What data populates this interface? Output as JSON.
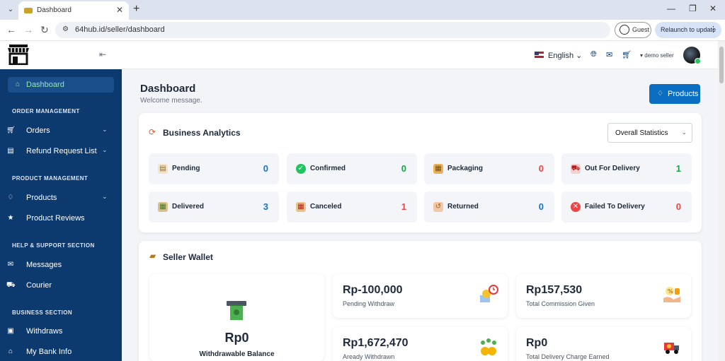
{
  "browser": {
    "tab_title": "Dashboard",
    "url": "64hub.id/seller/dashboard",
    "guest_label": "Guest",
    "relaunch_label": "Relaunch to update"
  },
  "sidebar": {
    "items": [
      {
        "label": "Dashboard",
        "icon": "home-icon"
      },
      {
        "label": "Orders",
        "icon": "cart-icon"
      },
      {
        "label": "Refund Request List",
        "icon": "list-icon"
      },
      {
        "label": "Products",
        "icon": "diamond-icon"
      },
      {
        "label": "Product Reviews",
        "icon": "star-icon"
      },
      {
        "label": "Messages",
        "icon": "message-icon"
      },
      {
        "label": "Courier",
        "icon": "courier-icon"
      },
      {
        "label": "Withdraws",
        "icon": "withdraw-icon"
      },
      {
        "label": "My Bank Info",
        "icon": "bank-icon"
      }
    ],
    "sections": [
      "ORDER MANAGEMENT",
      "PRODUCT MANAGEMENT",
      "HELP & SUPPORT SECTION",
      "BUSINESS SECTION"
    ]
  },
  "header": {
    "language": "English",
    "username": "demo seller"
  },
  "main": {
    "title": "Dashboard",
    "subtitle": "Welcome message.",
    "products_button": "Products"
  },
  "analytics": {
    "title": "Business Analytics",
    "filter_value": "Overall Statistics",
    "stats": [
      {
        "label": "Pending",
        "value": "0",
        "color": "#1a73c9"
      },
      {
        "label": "Confirmed",
        "value": "0",
        "color": "#16a34a"
      },
      {
        "label": "Packaging",
        "value": "0",
        "color": "#ef4444"
      },
      {
        "label": "Out For Delivery",
        "value": "1",
        "color": "#16a34a"
      },
      {
        "label": "Delivered",
        "value": "3",
        "color": "#1a73c9"
      },
      {
        "label": "Canceled",
        "value": "1",
        "color": "#ef4444"
      },
      {
        "label": "Returned",
        "value": "0",
        "color": "#1a73c9"
      },
      {
        "label": "Failed To Delivery",
        "value": "0",
        "color": "#ef4444"
      }
    ]
  },
  "wallet": {
    "title": "Seller Wallet",
    "withdrawable_value": "Rp0",
    "withdrawable_label": "Withdrawable Balance",
    "cards": [
      {
        "value": "Rp-100,000",
        "label": "Pending Withdraw"
      },
      {
        "value": "Rp157,530",
        "label": "Total Commission Given"
      },
      {
        "value": "Rp1,672,470",
        "label": "Aready Withdrawn"
      },
      {
        "value": "Rp0",
        "label": "Total Delivery Charge Earned"
      }
    ]
  }
}
